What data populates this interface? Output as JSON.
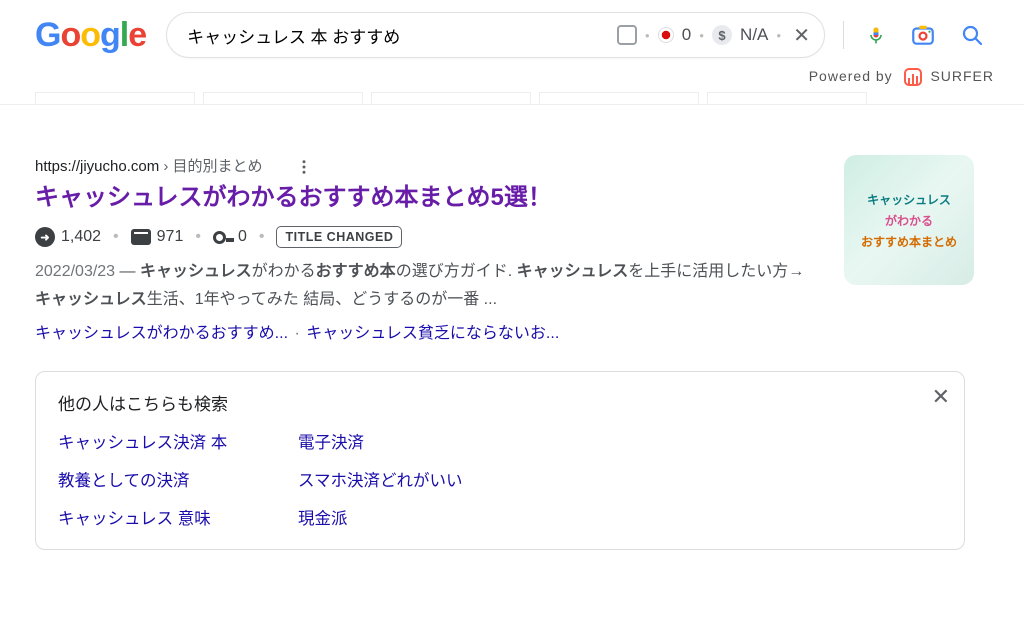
{
  "header": {
    "logo_chars": [
      "G",
      "o",
      "o",
      "g",
      "l",
      "e"
    ],
    "query": "キャッシュレス 本 おすすめ",
    "surfer": {
      "count": "0",
      "na": "N/A",
      "dollar": "$"
    },
    "powered_prefix": "Powered by",
    "powered_brand": "SURFER"
  },
  "result": {
    "url_host": "https://jiyucho.com",
    "url_path": " › 目的別まとめ",
    "title": "キャッシュレスがわかるおすすめ本まとめ5選！",
    "metrics": {
      "traffic": "1,402",
      "words": "971",
      "kw": "0"
    },
    "badge": "TITLE CHANGED",
    "date": "2022/03/23",
    "snippet_parts": {
      "sep": " — ",
      "b1": "キャッシュレス",
      "t1": "がわかる",
      "b2": "おすすめ本",
      "t2": "の選び方ガイド. ",
      "b3": "キャッシュレス",
      "t3": "を上手に活用したい方→",
      "b4": "キャッシュレス",
      "t4": "生活、1年やってみた 結局、どうするのが一番 ..."
    },
    "jump_links": [
      "キャッシュレスがわかるおすすめ... ",
      "キャッシュレス貧乏にならないお..."
    ],
    "thumb_lines": [
      "キャッシュレス",
      "がわかる",
      "おすすめ本まとめ"
    ]
  },
  "people_also": {
    "heading": "他の人はこちらも検索",
    "items": [
      "キャッシュレス決済 本",
      "電子決済",
      "教養としての決済",
      "スマホ決済どれがいい",
      "キャッシュレス 意味",
      "現金派"
    ]
  }
}
